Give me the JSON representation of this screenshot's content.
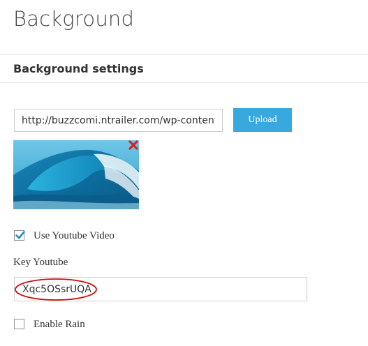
{
  "page": {
    "title": "Background",
    "section_title": "Background settings"
  },
  "background_upload": {
    "url_value": "http://buzzcomi.ntrailer.com/wp-content",
    "upload_label": "Upload",
    "preview_icon": "wave-image",
    "remove_icon": "close-icon"
  },
  "youtube": {
    "checkbox_label": "Use Youtube Video",
    "checked": true,
    "key_label": "Key Youtube",
    "key_value": "Xqc5OSsrUQA"
  },
  "rain": {
    "checkbox_label": "Enable Rain",
    "checked": false
  },
  "colors": {
    "accent": "#38a9de",
    "remove": "#e02020",
    "highlight": "#cc1111",
    "divider": "#e5e5e5"
  }
}
